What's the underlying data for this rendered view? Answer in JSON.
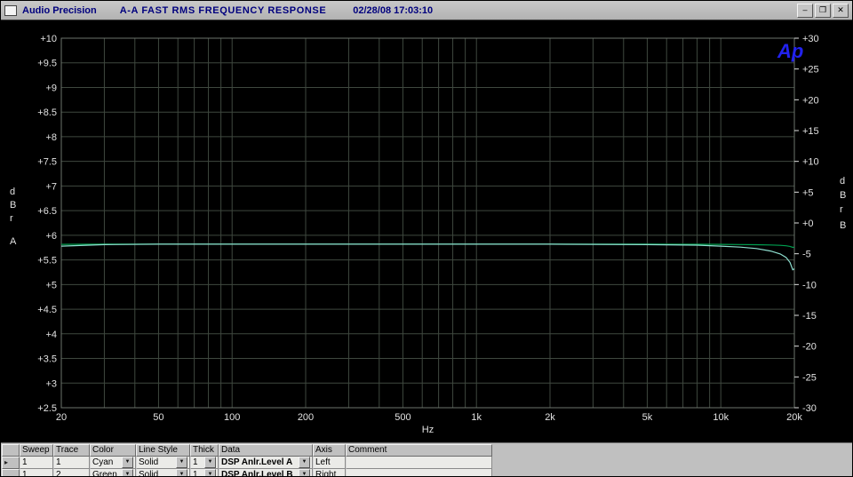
{
  "window": {
    "title": "Audio Precision",
    "subtitle": "A-A FAST RMS FREQUENCY RESPONSE",
    "timestamp": "02/28/08 17:03:10",
    "buttons": {
      "minimize": "–",
      "maximize": "❐",
      "close": "✕"
    }
  },
  "chart_data": {
    "type": "line",
    "x_scale": "log",
    "xlabel": "Hz",
    "x_range": [
      20,
      20000
    ],
    "x_gridlines": [
      20,
      30,
      40,
      50,
      60,
      70,
      80,
      90,
      100,
      200,
      300,
      400,
      500,
      600,
      700,
      800,
      900,
      1000,
      2000,
      3000,
      4000,
      5000,
      6000,
      7000,
      8000,
      9000,
      10000,
      20000
    ],
    "x_ticks": [
      {
        "value": 20,
        "label": "20"
      },
      {
        "value": 50,
        "label": "50"
      },
      {
        "value": 100,
        "label": "100"
      },
      {
        "value": 200,
        "label": "200"
      },
      {
        "value": 500,
        "label": "500"
      },
      {
        "value": 1000,
        "label": "1k"
      },
      {
        "value": 2000,
        "label": "2k"
      },
      {
        "value": 5000,
        "label": "5k"
      },
      {
        "value": 10000,
        "label": "10k"
      },
      {
        "value": 20000,
        "label": "20k"
      }
    ],
    "left_axis": {
      "unit": "dBr",
      "channel": "A",
      "range": [
        2.5,
        10
      ],
      "ticks": [
        {
          "value": 10,
          "label": "+10"
        },
        {
          "value": 9.5,
          "label": "+9.5"
        },
        {
          "value": 9,
          "label": "+9"
        },
        {
          "value": 8.5,
          "label": "+8.5"
        },
        {
          "value": 8,
          "label": "+8"
        },
        {
          "value": 7.5,
          "label": "+7.5"
        },
        {
          "value": 7,
          "label": "+7"
        },
        {
          "value": 6.5,
          "label": "+6.5"
        },
        {
          "value": 6,
          "label": "+6"
        },
        {
          "value": 5.5,
          "label": "+5.5"
        },
        {
          "value": 5,
          "label": "+5"
        },
        {
          "value": 4.5,
          "label": "+4.5"
        },
        {
          "value": 4,
          "label": "+4"
        },
        {
          "value": 3.5,
          "label": "+3.5"
        },
        {
          "value": 3,
          "label": "+3"
        },
        {
          "value": 2.5,
          "label": "+2.5"
        }
      ]
    },
    "right_axis": {
      "unit": "dBr",
      "channel": "B",
      "range": [
        -30,
        30
      ],
      "ticks": [
        {
          "value": 30,
          "label": "+30"
        },
        {
          "value": 25,
          "label": "+25"
        },
        {
          "value": 20,
          "label": "+20"
        },
        {
          "value": 15,
          "label": "+15"
        },
        {
          "value": 10,
          "label": "+10"
        },
        {
          "value": 5,
          "label": "+5"
        },
        {
          "value": 0,
          "label": "+0"
        },
        {
          "value": -5,
          "label": "-5"
        },
        {
          "value": -10,
          "label": "-10"
        },
        {
          "value": -15,
          "label": "-15"
        },
        {
          "value": -20,
          "label": "-20"
        },
        {
          "value": -25,
          "label": "-25"
        },
        {
          "value": -30,
          "label": "-30"
        }
      ]
    },
    "series": [
      {
        "name": "DSP Anlr.Level B",
        "color": "#00a050",
        "axis": "right",
        "x": [
          20,
          30,
          50,
          100,
          200,
          500,
          1000,
          2000,
          5000,
          8000,
          10000,
          12000,
          14000,
          16000,
          17500,
          18500,
          19200,
          19700,
          20000
        ],
        "y": [
          -3.48,
          -3.45,
          -3.44,
          -3.44,
          -3.44,
          -3.44,
          -3.44,
          -3.44,
          -3.45,
          -3.46,
          -3.48,
          -3.5,
          -3.53,
          -3.58,
          -3.64,
          -3.71,
          -3.81,
          -3.96,
          -3.94
        ]
      },
      {
        "name": "DSP Anlr.Level A",
        "color": "#8fe0d0",
        "axis": "left",
        "x": [
          20,
          30,
          50,
          100,
          200,
          500,
          1000,
          2000,
          5000,
          8000,
          10000,
          12000,
          14000,
          16000,
          17500,
          18500,
          19200,
          19700,
          20000
        ],
        "y": [
          5.78,
          5.81,
          5.82,
          5.82,
          5.82,
          5.82,
          5.82,
          5.82,
          5.81,
          5.8,
          5.78,
          5.76,
          5.73,
          5.68,
          5.62,
          5.55,
          5.45,
          5.3,
          5.32
        ]
      }
    ],
    "logo": "Ap",
    "colors": {
      "background": "#000000",
      "grid": "#3f483f",
      "border": "#6d756d",
      "text": "#e2e2e2",
      "logo": "#2222ee"
    }
  },
  "trace_table": {
    "headers": [
      "Sweep",
      "Trace",
      "Color",
      "Line Style",
      "Thick",
      "Data",
      "Axis",
      "Comment"
    ],
    "row_selector_glyph": "▸",
    "dropdown_glyph": "▼",
    "rows": [
      {
        "sweep": "1",
        "trace": "1",
        "color": "Cyan",
        "line_style": "Solid",
        "thick": "1",
        "data": "DSP Anlr.Level A",
        "axis": "Left",
        "comment": ""
      },
      {
        "sweep": "1",
        "trace": "2",
        "color": "Green",
        "line_style": "Solid",
        "thick": "1",
        "data": "DSP Anlr.Level B",
        "axis": "Right",
        "comment": ""
      }
    ]
  }
}
